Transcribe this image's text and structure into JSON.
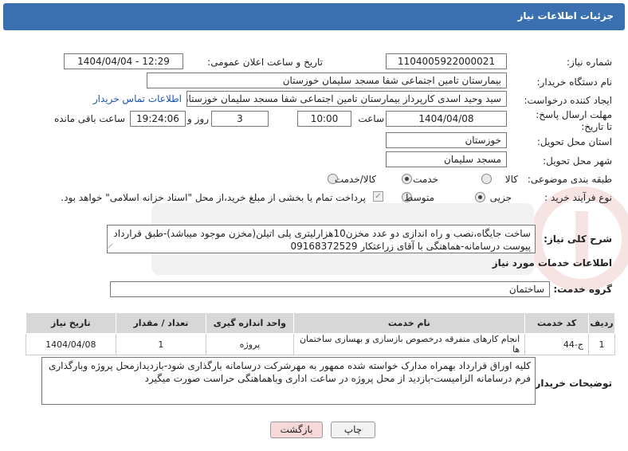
{
  "header": {
    "title": "جزئیات اطلاعات نیاز"
  },
  "fields": {
    "need_number": {
      "label": "شماره نیاز:",
      "value": "1104005922000021"
    },
    "announce": {
      "label": "تاریخ و ساعت اعلان عمومی:",
      "value": "1404/04/04 - 12:29"
    },
    "buyer_org": {
      "label": "نام دستگاه خریدار:",
      "value": "بیمارستان تامین اجتماعی شفا مسجد سلیمان خوزستان"
    },
    "creator": {
      "label": "ایجاد کننده درخواست:",
      "value": "سید وحید اسدی کارپرداز بیمارستان تامین اجتماعی شفا مسجد سلیمان خوزستان",
      "contact_link": "اطلاعات تماس خریدار"
    },
    "deadline": {
      "label": "مهلت ارسال پاسخ: تا تاریخ:",
      "date": "1404/04/08",
      "time_label": "ساعت",
      "time": "10:00",
      "days": "3",
      "days_label": "روز و",
      "remaining": "19:24:06",
      "remaining_label": "ساعت باقی مانده"
    },
    "province": {
      "label": "استان محل تحویل:",
      "value": "خوزستان"
    },
    "city": {
      "label": "شهر محل تحویل:",
      "value": "مسجد سلیمان"
    },
    "category": {
      "label": "طبقه بندی موضوعی:",
      "options": [
        "کالا",
        "خدمت",
        "کالا/خدمت"
      ],
      "selected": "خدمت"
    },
    "process": {
      "label": "نوع فرآیند خرید :",
      "options": [
        "جزیی",
        "متوسط"
      ],
      "selected": "جزیی",
      "note": "پرداخت تمام یا بخشی از مبلغ خرید،از محل \"اسناد خزانه اسلامی\" خواهد بود."
    }
  },
  "summary": {
    "label": "شرح کلی نیاز:",
    "text": "ساخت جایگاه،نصب و راه اندازی دو عدد مخزن10هزارلیتری پلی اتیلن(مخزن موجود میباشد)-طبق قرارداد پیوست درسامانه-هماهنگی با آقای زراعتکار 09168372529"
  },
  "services": {
    "section_title": "اطلاعات خدمات مورد نیاز",
    "group_label": "گروه خدمت:",
    "group_value": "ساختمان",
    "columns": [
      "ردیف",
      "کد خدمت",
      "نام خدمت",
      "واحد اندازه گیری",
      "تعداد / مقدار",
      "تاریخ نیاز"
    ],
    "rows": [
      [
        "1",
        "ج-44",
        "انجام کارهای متفرقه درخصوص بازسازی و بهسازی ساختمان ها",
        "پروژه",
        "1",
        "1404/04/08"
      ]
    ]
  },
  "buyer_notes": {
    "label": "توضیحات خریدار:",
    "text": "کلیه اوراق قرارداد بهمراه مدارک خواسته شده ممهور به مهرشرکت درسامانه بارگذاری شود-بازدیدازمحل پروژه وبارگذاری فرم درسامانه الزامیست-بازدید از محل پروژه در ساعت اداری وباهماهنگی حراست صورت میگیرد"
  },
  "buttons": {
    "print": "چاپ",
    "back": "بازگشت"
  },
  "colors": {
    "header": "#3b70b0",
    "table_header": "#d7d7d7",
    "back_button": "#f6d8d8",
    "link": "#1a56b0"
  }
}
